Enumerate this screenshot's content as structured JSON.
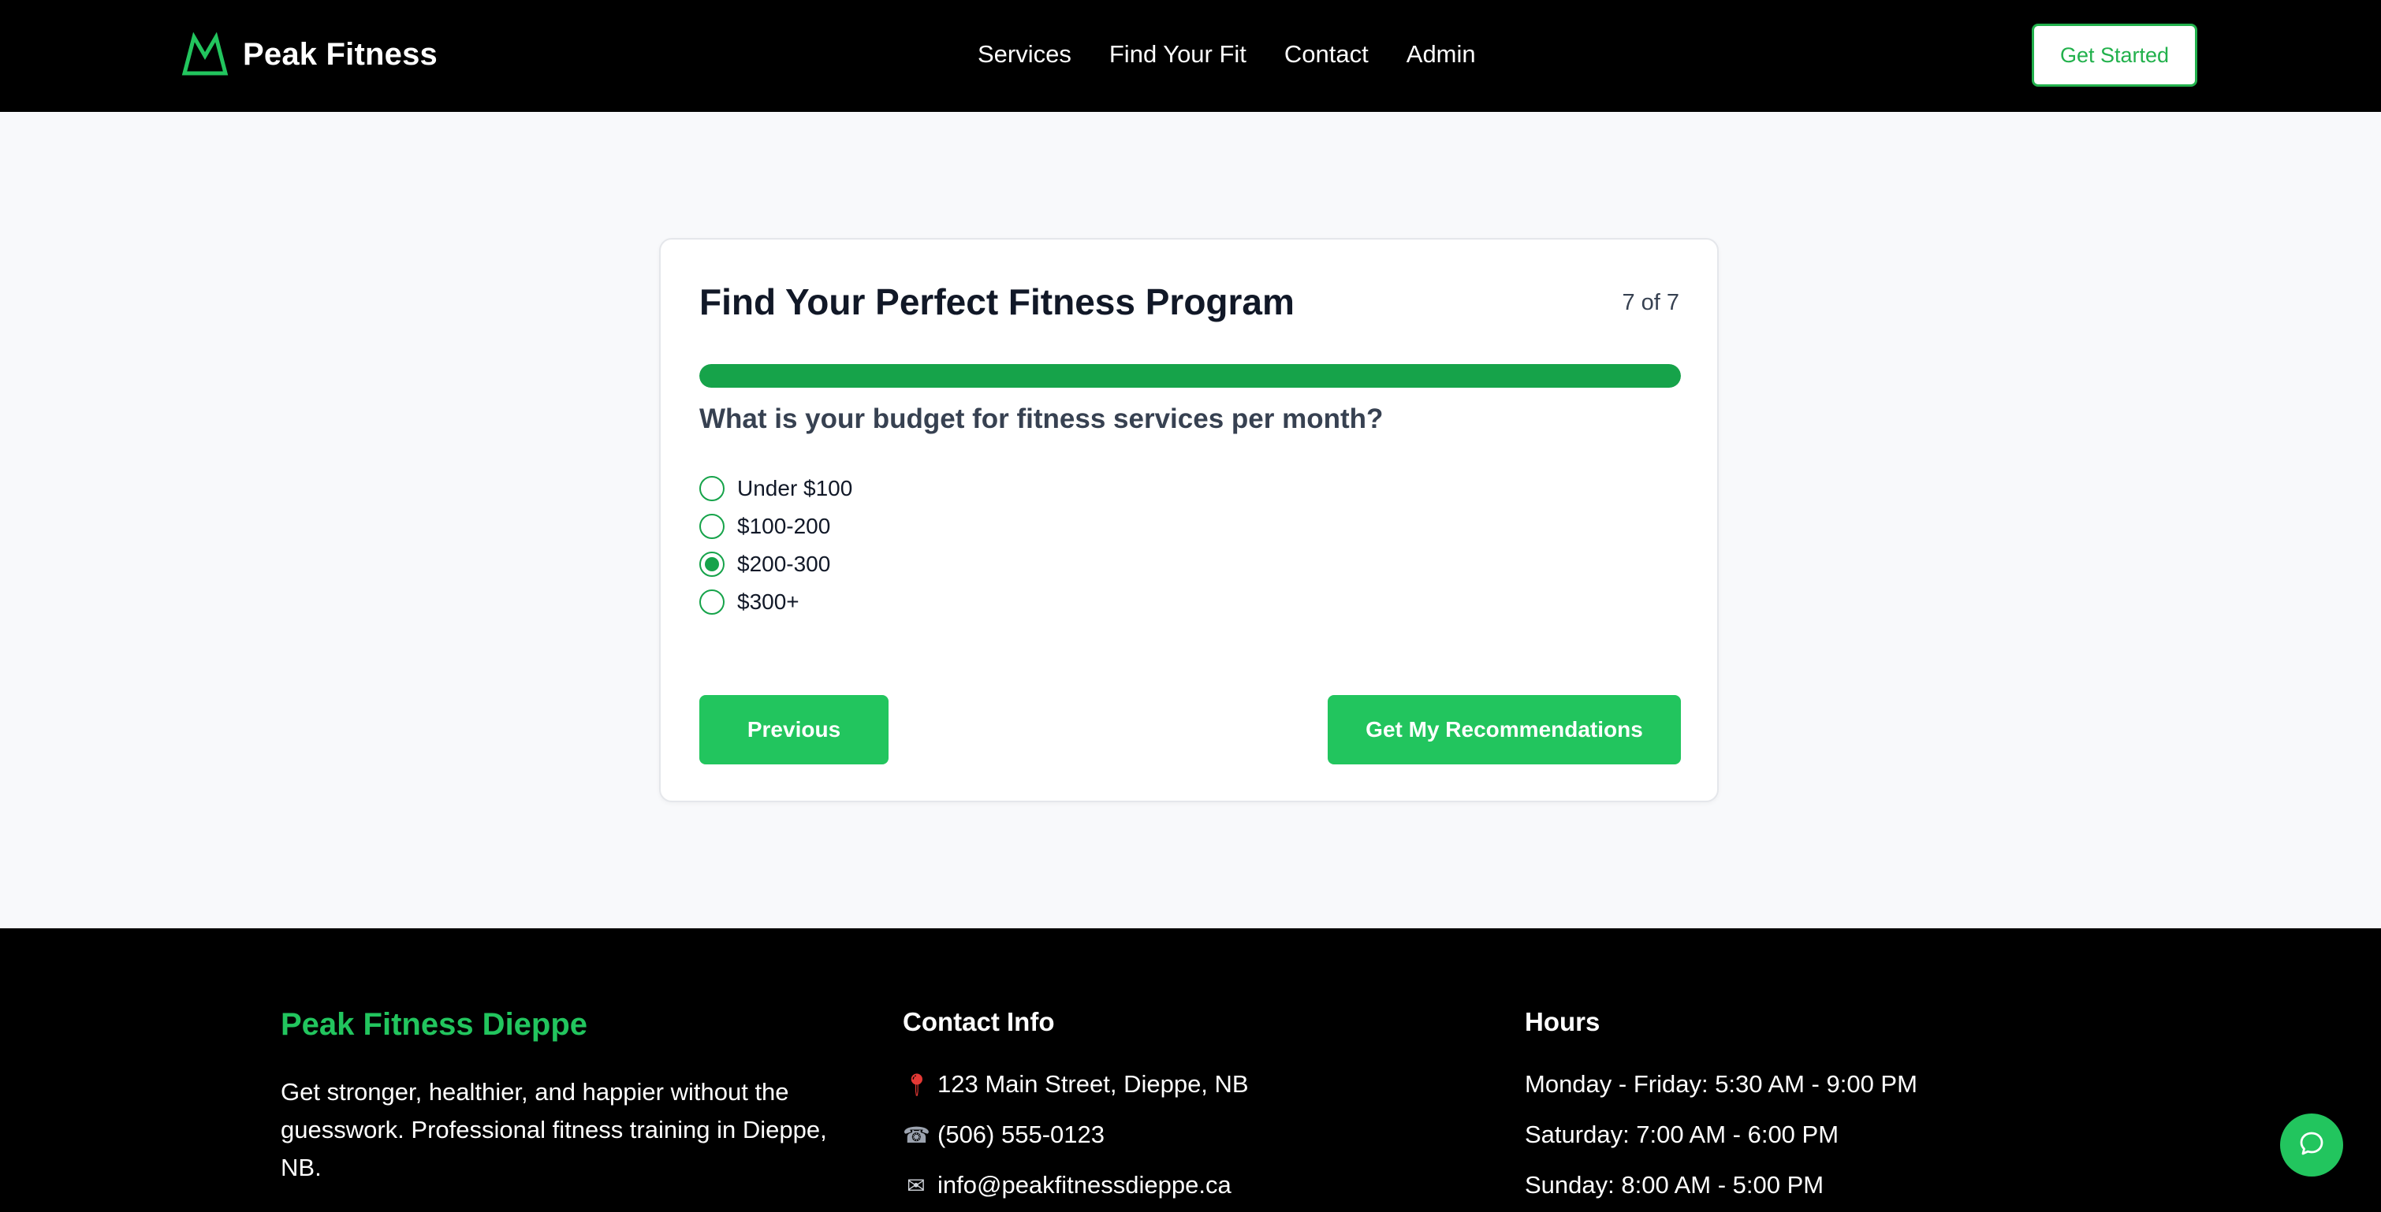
{
  "header": {
    "brand": "Peak Fitness",
    "nav": [
      "Services",
      "Find Your Fit",
      "Contact",
      "Admin"
    ],
    "cta": "Get Started"
  },
  "quiz": {
    "title": "Find Your Perfect Fitness Program",
    "step": "7 of 7",
    "progress_fraction": 1.0,
    "question": "What is your budget for fitness services per month?",
    "options": [
      {
        "label": "Under $100",
        "selected": false
      },
      {
        "label": "$100-200",
        "selected": false
      },
      {
        "label": "$200-300",
        "selected": true
      },
      {
        "label": "$300+",
        "selected": false
      }
    ],
    "previous_label": "Previous",
    "next_label": "Get My Recommendations"
  },
  "footer": {
    "brand": "Peak Fitness Dieppe",
    "description": "Get stronger, healthier, and happier without the guesswork. Professional fitness training in Dieppe, NB.",
    "contact": {
      "heading": "Contact Info",
      "address": "123 Main Street, Dieppe, NB",
      "phone": "(506) 555-0123",
      "email": "info@peakfitnessdieppe.ca"
    },
    "hours": {
      "heading": "Hours",
      "weekday": "Monday - Friday: 5:30 AM - 9:00 PM",
      "saturday": "Saturday: 7:00 AM - 6:00 PM",
      "sunday": "Sunday: 8:00 AM - 5:00 PM"
    }
  },
  "colors": {
    "accent": "#22c55e",
    "progress": "#16a34a",
    "header_bg": "#000000",
    "page_bg": "#f8f9fb"
  },
  "icons": {
    "logo": "mountain-icon",
    "address": "pin-icon",
    "phone": "phone-icon",
    "email": "envelope-icon",
    "chat": "chat-bubble-icon"
  }
}
